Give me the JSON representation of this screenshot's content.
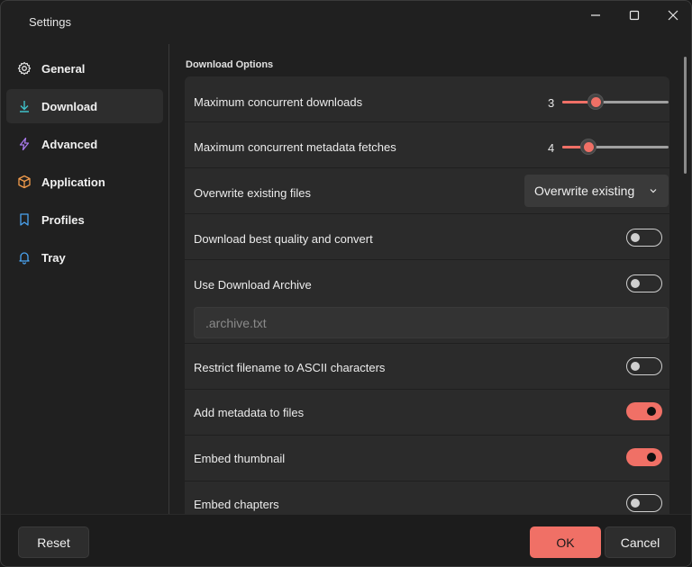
{
  "window": {
    "title": "Settings",
    "controls": [
      "minimize-icon",
      "maximize-icon",
      "close-icon"
    ]
  },
  "sidebar": {
    "items": [
      {
        "label": "General",
        "icon": "gear-icon",
        "active": false
      },
      {
        "label": "Download",
        "icon": "download-icon",
        "active": true
      },
      {
        "label": "Advanced",
        "icon": "lightning-icon",
        "active": false
      },
      {
        "label": "Application",
        "icon": "box-icon",
        "active": false
      },
      {
        "label": "Profiles",
        "icon": "bookmark-icon",
        "active": false
      },
      {
        "label": "Tray",
        "icon": "bell-icon",
        "active": false
      }
    ]
  },
  "main": {
    "section_title": "Download Options",
    "settings": {
      "max_downloads": {
        "label": "Maximum concurrent downloads",
        "value": "3"
      },
      "max_metadata": {
        "label": "Maximum concurrent metadata fetches",
        "value": "4"
      },
      "overwrite": {
        "label": "Overwrite existing files",
        "selected": "Overwrite existing"
      },
      "best_quality": {
        "label": "Download best quality and convert",
        "on": false
      },
      "archive": {
        "label": "Use Download Archive",
        "on": false,
        "placeholder": ".archive.txt"
      },
      "ascii": {
        "label": "Restrict filename to ASCII characters",
        "on": false
      },
      "metadata": {
        "label": "Add metadata to files",
        "on": true
      },
      "thumbnail": {
        "label": "Embed thumbnail",
        "on": true
      },
      "chapters": {
        "label": "Embed chapters",
        "on": false
      }
    }
  },
  "footer": {
    "reset_label": "Reset",
    "ok_label": "OK",
    "cancel_label": "Cancel"
  },
  "colors": {
    "accent": "#f07066",
    "background": "#202020",
    "card": "#2b2b2b"
  }
}
